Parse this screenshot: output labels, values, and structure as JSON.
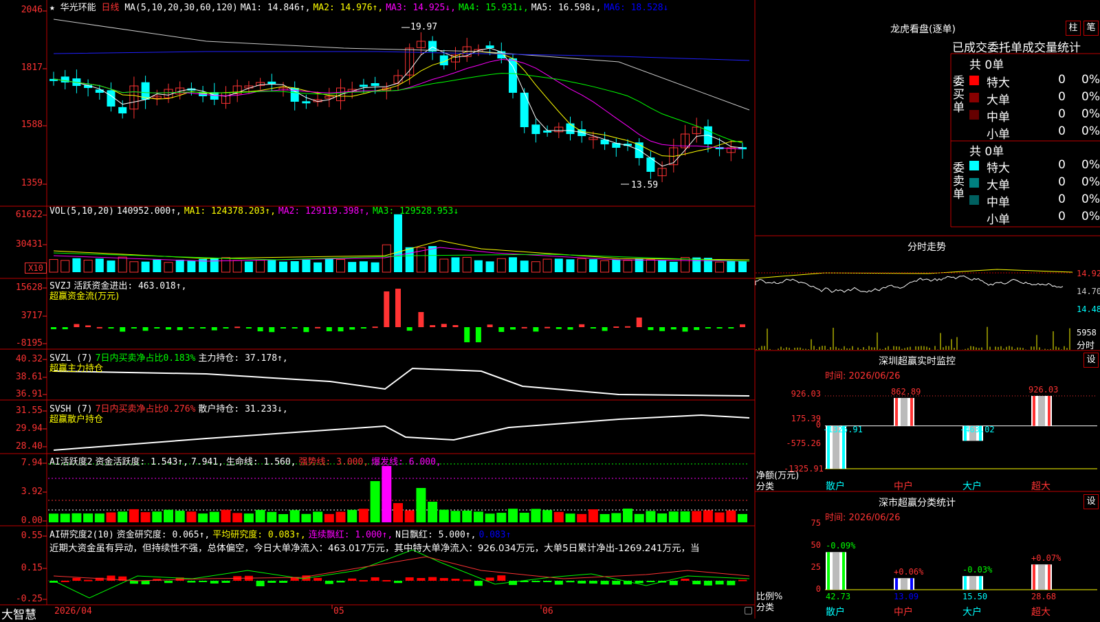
{
  "stock": {
    "name": "华光环能",
    "period": "日线"
  },
  "price_panel": {
    "y_ticks": [
      "2046",
      "1817",
      "1588",
      "1359"
    ],
    "ma_header": [
      {
        "text": "MA(5,10,20,30,60,120)",
        "color": "#ffffff"
      },
      {
        "text": "MA1: 14.846↑,",
        "color": "#ffffff"
      },
      {
        "text": "MA2: 14.976↑,",
        "color": "#ffff00"
      },
      {
        "text": "MA3: 14.925↓,",
        "color": "#ff00ff"
      },
      {
        "text": "MA4: 15.931↓,",
        "color": "#00ff00"
      },
      {
        "text": "MA5: 16.598↓,",
        "color": "#ffffff"
      },
      {
        "text": "MA6: 18.528↓",
        "color": "#0000ff"
      }
    ],
    "high_label": "19.97",
    "low_label": "13.59",
    "star": "★"
  },
  "vol_panel": {
    "y_ticks": [
      "61622",
      "30431"
    ],
    "unit_badge": "X10",
    "header": [
      {
        "text": "VOL(5,10,20)",
        "color": "#ffffff"
      },
      {
        "text": "140952.000↑,",
        "color": "#ffffff"
      },
      {
        "text": "MA1: 124378.203↑,",
        "color": "#ffff00"
      },
      {
        "text": "MA2: 129119.398↑,",
        "color": "#ff00ff"
      },
      {
        "text": "MA3: 129528.953↓",
        "color": "#00ff00"
      }
    ]
  },
  "svzj_panel": {
    "y_ticks": [
      "15628",
      "3717",
      "-8195"
    ],
    "header": [
      {
        "text": "SVZJ",
        "color": "#ffffff"
      },
      {
        "text": "活跃资金进出: 463.018↑,",
        "color": "#ffffff"
      }
    ],
    "sub": "超赢资金流(万元)"
  },
  "svzl_panel": {
    "y_ticks": [
      "40.32",
      "38.61",
      "36.91"
    ],
    "header": [
      {
        "text": "SVZL (7)",
        "color": "#ffffff"
      },
      {
        "text": "7日内买卖净占比0.183%",
        "color": "#00ff00"
      },
      {
        "text": "主力持仓: 37.178↑,",
        "color": "#ffffff"
      }
    ],
    "sub": "超赢主力持仓"
  },
  "svsh_panel": {
    "y_ticks": [
      "31.55",
      "29.94",
      "28.40"
    ],
    "header": [
      {
        "text": "SVSH (7)",
        "color": "#ffffff"
      },
      {
        "text": "7日内买卖净占比0.276%",
        "color": "#ff3333"
      },
      {
        "text": "散户持仓: 31.233↓,",
        "color": "#ffffff"
      }
    ],
    "sub": "超赢散户持仓"
  },
  "ai_active_panel": {
    "y_ticks": [
      "7.94",
      "3.92",
      "0.00"
    ],
    "header": [
      {
        "text": "AI活跃度2",
        "color": "#ffffff"
      },
      {
        "text": "资金活跃度: 1.543↑,",
        "color": "#ffffff"
      },
      {
        "text": "7.941,",
        "color": "#ffffff"
      },
      {
        "text": "生命线: 1.560,",
        "color": "#ffffff"
      },
      {
        "text": "强势线: 3.000,",
        "color": "#ff3333"
      },
      {
        "text": "爆发线: 6.000,",
        "color": "#ff00ff"
      }
    ]
  },
  "ai_research_panel": {
    "y_ticks": [
      "0.55",
      "0.15",
      "-0.25"
    ],
    "header": [
      {
        "text": "AI研究度2(10)",
        "color": "#ffffff"
      },
      {
        "text": "资金研究度: 0.065↑,",
        "color": "#ffffff"
      },
      {
        "text": "平均研究度: 0.083↑,",
        "color": "#ffff00"
      },
      {
        "text": "连续飘红: 1.000↑,",
        "color": "#ff00ff"
      },
      {
        "text": "N日飘红: 5.000↑,",
        "color": "#ffffff"
      },
      {
        "text": "0.083↑",
        "color": "#0000ff"
      }
    ],
    "comment": "近期大资金虽有异动，但持续性不强，总体偏空，今日大单净流入：463.017万元，其中特大单净流入：926.034万元，大单5日累计净出-1269.241万元，当"
  },
  "x_axis": {
    "labels": [
      "2026/04",
      "05",
      "06"
    ],
    "brand": "大智慧"
  },
  "dragon_tiger": {
    "title": "龙虎看盘(逐单)",
    "btn_a": "柱",
    "btn_b": "笔",
    "stats_title": "已成交委托单成交量统计",
    "buy_label": "委买单",
    "sell_label": "委卖单",
    "buy_total": "共 0单",
    "sell_total": "共 0单",
    "buy_rows": [
      {
        "name": "特大",
        "count": "0",
        "pct": "0%",
        "color": "#ff0000"
      },
      {
        "name": "大单",
        "count": "0",
        "pct": "0%",
        "color": "#880000"
      },
      {
        "name": "中单",
        "count": "0",
        "pct": "0%",
        "color": "#660000"
      },
      {
        "name": "小单",
        "count": "0",
        "pct": "0%",
        "color": "#000000"
      }
    ],
    "sell_rows": [
      {
        "name": "特大",
        "count": "0",
        "pct": "0%",
        "color": "#00ffff"
      },
      {
        "name": "大单",
        "count": "0",
        "pct": "0%",
        "color": "#008080"
      },
      {
        "name": "中单",
        "count": "0",
        "pct": "0%",
        "color": "#006060"
      },
      {
        "name": "小单",
        "count": "0",
        "pct": "0%",
        "color": "#000000"
      }
    ]
  },
  "intraday": {
    "title": "分时走势",
    "price_labels": [
      "14.92",
      "14.70",
      "14.48"
    ],
    "vol_label": "5958",
    "vol_unit": "分时"
  },
  "sz_monitor": {
    "title": "深圳超赢实时监控",
    "settings": "设",
    "time": "时间: 2026/06/26",
    "y_ticks": [
      "926.03",
      "175.39",
      "0",
      "-575.26",
      "-1325.91"
    ],
    "unit_label": "净额(万元)",
    "cat_label": "分类",
    "categories": [
      "散户",
      "中户",
      "大户",
      "超大"
    ],
    "values": [
      "-1325.91",
      "862.89",
      "-463.02",
      "926.03"
    ]
  },
  "sz_classify": {
    "title": "深市超赢分类统计",
    "settings": "设",
    "time": "时间: 2026/06/26",
    "y_ticks": [
      "75",
      "50",
      "25",
      "0"
    ],
    "unit_label": "比例%",
    "cat_label": "分类",
    "categories": [
      "散户",
      "中户",
      "大户",
      "超大"
    ],
    "changes": [
      "-0.09%",
      "+0.06%",
      "-0.03%",
      "+0.07%"
    ],
    "values": [
      "42.73",
      "13.09",
      "15.50",
      "28.68"
    ]
  },
  "chart_data": [
    {
      "type": "bar",
      "title": "深圳超赢实时监控",
      "ylabel": "净额(万元)",
      "categories": [
        "散户",
        "中户",
        "大户",
        "超大"
      ],
      "values": [
        -1325.91,
        862.89,
        -463.02,
        926.03
      ],
      "ylim": [
        -1325.91,
        926.03
      ]
    },
    {
      "type": "bar",
      "title": "深市超赢分类统计",
      "ylabel": "比例%",
      "categories": [
        "散户",
        "中户",
        "大户",
        "超大"
      ],
      "values": [
        42.73,
        13.09,
        15.5,
        28.68
      ],
      "ylim": [
        0,
        75
      ]
    }
  ],
  "colors": {
    "up": "#ff3333",
    "down": "#00ffff",
    "green": "#00ff00",
    "grid": "#c00000",
    "axis": "#ff2020"
  }
}
